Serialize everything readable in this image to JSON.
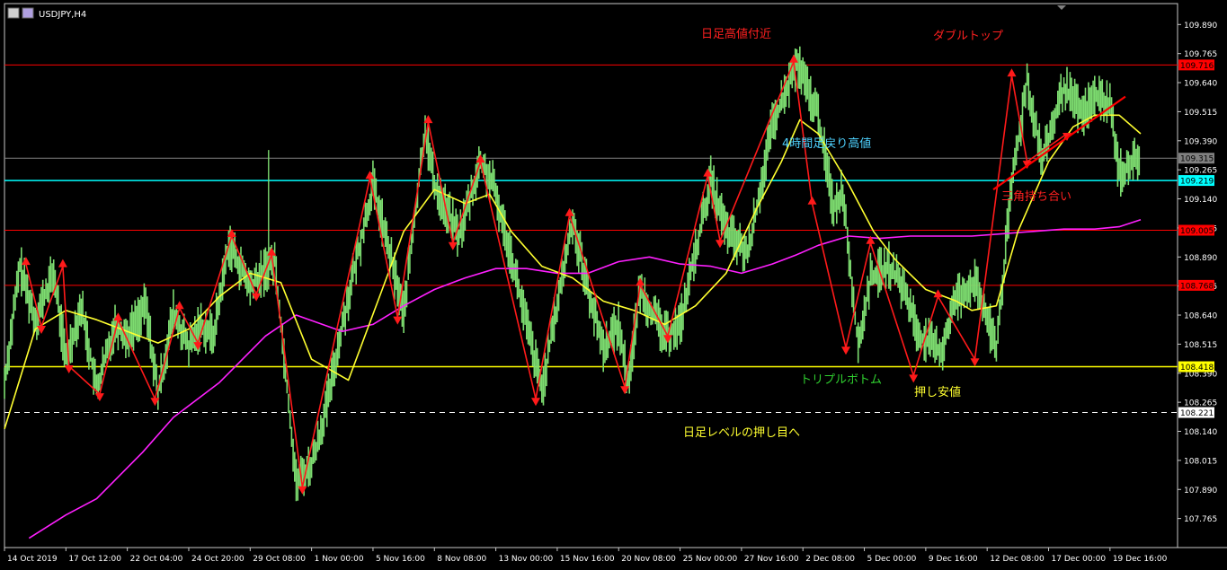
{
  "window": {
    "title": "USDJPY,H4"
  },
  "chart_data": {
    "type": "line",
    "symbol": "USDJPY,H4",
    "ylim": [
      107.64,
      109.98
    ],
    "y_ticks": [
      "109.890",
      "109.765",
      "109.640",
      "109.515",
      "109.390",
      "109.265",
      "109.140",
      "109.015",
      "108.890",
      "108.765",
      "108.640",
      "108.515",
      "108.390",
      "108.265",
      "108.140",
      "108.015",
      "107.890",
      "107.765"
    ],
    "x_labels": [
      "14 Oct 2019",
      "17 Oct 12:00",
      "22 Oct 04:00",
      "24 Oct 20:00",
      "29 Oct 08:00",
      "1 Nov 00:00",
      "5 Nov 16:00",
      "8 Nov 08:00",
      "13 Nov 00:00",
      "15 Nov 16:00",
      "20 Nov 08:00",
      "25 Nov 00:00",
      "27 Nov 16:00",
      "2 Dec 08:00",
      "5 Dec 00:00",
      "9 Dec 16:00",
      "12 Dec 08:00",
      "17 Dec 00:00",
      "19 Dec 16:00"
    ],
    "levels": [
      {
        "price": 109.716,
        "label": "109.716",
        "color": "#ff0000",
        "style": "solid"
      },
      {
        "price": 109.315,
        "label": "109.315",
        "color": "#808080",
        "style": "solid"
      },
      {
        "price": 109.219,
        "label": "109.219",
        "color": "#00ffff",
        "style": "solid"
      },
      {
        "price": 109.005,
        "label": "109.005",
        "color": "#ff0000",
        "style": "solid"
      },
      {
        "price": 108.768,
        "label": "108.768",
        "color": "#ff0000",
        "style": "solid"
      },
      {
        "price": 108.418,
        "label": "108.418",
        "color": "#ffff00",
        "style": "solid"
      },
      {
        "price": 108.221,
        "label": "108.221",
        "color": "#ffffff",
        "style": "dashed"
      }
    ],
    "price_path": [
      [
        0,
        108.35
      ],
      [
        0.5,
        108.85
      ],
      [
        1,
        108.62
      ],
      [
        1.6,
        108.82
      ],
      [
        2,
        108.45
      ],
      [
        2.5,
        108.68
      ],
      [
        3,
        108.32
      ],
      [
        3.6,
        108.6
      ],
      [
        4,
        108.55
      ],
      [
        4.6,
        108.68
      ],
      [
        5,
        108.3
      ],
      [
        5.5,
        108.65
      ],
      [
        6,
        108.5
      ],
      [
        6.4,
        108.6
      ],
      [
        6.8,
        108.55
      ],
      [
        7.3,
        108.95
      ],
      [
        8,
        108.76
      ],
      [
        8.8,
        108.88
      ],
      [
        9.3,
        108.2
      ],
      [
        9.5,
        107.92
      ],
      [
        10,
        108.0
      ],
      [
        10.5,
        108.25
      ],
      [
        11,
        108.6
      ],
      [
        12,
        109.2
      ],
      [
        13,
        108.65
      ],
      [
        13.7,
        109.45
      ],
      [
        14,
        109.2
      ],
      [
        14.8,
        108.98
      ],
      [
        15.5,
        109.3
      ],
      [
        15.9,
        109.2
      ],
      [
        16.5,
        108.9
      ],
      [
        17,
        108.6
      ],
      [
        17.5,
        108.32
      ],
      [
        18.5,
        109.05
      ],
      [
        19,
        108.75
      ],
      [
        19.5,
        108.5
      ],
      [
        20,
        108.6
      ],
      [
        20.3,
        108.35
      ],
      [
        20.7,
        108.75
      ],
      [
        21.5,
        108.55
      ],
      [
        22,
        108.6
      ],
      [
        23,
        109.22
      ],
      [
        23.5,
        109.0
      ],
      [
        24.2,
        108.9
      ],
      [
        25,
        109.45
      ],
      [
        25.8,
        109.72
      ],
      [
        26.5,
        109.5
      ],
      [
        27,
        109.1
      ],
      [
        27.3,
        109.18
      ],
      [
        27.8,
        108.5
      ],
      [
        28.2,
        108.8
      ],
      [
        28.8,
        108.85
      ],
      [
        29.3,
        108.75
      ],
      [
        29.8,
        108.55
      ],
      [
        30.5,
        108.48
      ],
      [
        31,
        108.72
      ],
      [
        31.6,
        108.78
      ],
      [
        32.3,
        108.5
      ],
      [
        32.8,
        109.2
      ],
      [
        33.3,
        109.65
      ],
      [
        33.8,
        109.3
      ],
      [
        34.5,
        109.62
      ],
      [
        35.1,
        109.5
      ],
      [
        35.5,
        109.58
      ],
      [
        36,
        109.55
      ],
      [
        36.3,
        109.25
      ],
      [
        37,
        109.32
      ]
    ],
    "ma_yellow": [
      [
        0,
        108.15
      ],
      [
        1,
        108.58
      ],
      [
        2,
        108.66
      ],
      [
        3,
        108.62
      ],
      [
        4,
        108.57
      ],
      [
        5,
        108.52
      ],
      [
        6,
        108.58
      ],
      [
        7,
        108.72
      ],
      [
        8,
        108.82
      ],
      [
        9,
        108.78
      ],
      [
        10,
        108.45
      ],
      [
        11.2,
        108.36
      ],
      [
        12.3,
        108.75
      ],
      [
        13,
        109.0
      ],
      [
        14,
        109.18
      ],
      [
        15,
        109.12
      ],
      [
        15.8,
        109.16
      ],
      [
        16.5,
        109.0
      ],
      [
        17.5,
        108.85
      ],
      [
        18.5,
        108.8
      ],
      [
        19.5,
        108.7
      ],
      [
        20.5,
        108.66
      ],
      [
        21.5,
        108.6
      ],
      [
        22.5,
        108.68
      ],
      [
        23.5,
        108.82
      ],
      [
        24.5,
        109.1
      ],
      [
        25.3,
        109.3
      ],
      [
        25.9,
        109.48
      ],
      [
        26.5,
        109.42
      ],
      [
        27.5,
        109.2
      ],
      [
        28.3,
        109.0
      ],
      [
        29,
        108.88
      ],
      [
        30,
        108.75
      ],
      [
        31,
        108.7
      ],
      [
        31.5,
        108.66
      ],
      [
        32.3,
        108.68
      ],
      [
        33,
        109.0
      ],
      [
        34,
        109.3
      ],
      [
        34.8,
        109.45
      ],
      [
        35.5,
        109.5
      ],
      [
        36.3,
        109.5
      ],
      [
        37,
        109.42
      ]
    ],
    "ma_magenta": [
      [
        0.8,
        107.68
      ],
      [
        2,
        107.78
      ],
      [
        3,
        107.85
      ],
      [
        4.5,
        108.05
      ],
      [
        5.5,
        108.2
      ],
      [
        7,
        108.35
      ],
      [
        8.5,
        108.55
      ],
      [
        9.5,
        108.64
      ],
      [
        11,
        108.57
      ],
      [
        12,
        108.6
      ],
      [
        13,
        108.68
      ],
      [
        14,
        108.75
      ],
      [
        15,
        108.8
      ],
      [
        16,
        108.84
      ],
      [
        17,
        108.84
      ],
      [
        18,
        108.82
      ],
      [
        19,
        108.82
      ],
      [
        20,
        108.87
      ],
      [
        21,
        108.89
      ],
      [
        22,
        108.86
      ],
      [
        23,
        108.85
      ],
      [
        24,
        108.82
      ],
      [
        25,
        108.86
      ],
      [
        25.8,
        108.9
      ],
      [
        26.5,
        108.94
      ],
      [
        27.5,
        108.98
      ],
      [
        28.5,
        108.97
      ],
      [
        29.5,
        108.98
      ],
      [
        30.5,
        108.98
      ],
      [
        31.5,
        108.98
      ],
      [
        32.5,
        108.99
      ],
      [
        33.5,
        109.0
      ],
      [
        34.5,
        109.01
      ],
      [
        35.5,
        109.01
      ],
      [
        36.3,
        109.02
      ],
      [
        37,
        109.05
      ]
    ],
    "red_arrows": [
      {
        "t": 0.7,
        "p": 108.86,
        "dir": "up"
      },
      {
        "t": 1.2,
        "p": 108.59,
        "dir": "down"
      },
      {
        "t": 1.9,
        "p": 108.85,
        "dir": "up"
      },
      {
        "t": 2.1,
        "p": 108.42,
        "dir": "down"
      },
      {
        "t": 3.1,
        "p": 108.3,
        "dir": "down"
      },
      {
        "t": 3.7,
        "p": 108.62,
        "dir": "up"
      },
      {
        "t": 4.9,
        "p": 108.28,
        "dir": "down"
      },
      {
        "t": 5.7,
        "p": 108.67,
        "dir": "up"
      },
      {
        "t": 6.3,
        "p": 108.52,
        "dir": "down"
      },
      {
        "t": 7.4,
        "p": 108.98,
        "dir": "up"
      },
      {
        "t": 8.2,
        "p": 108.73,
        "dir": "down"
      },
      {
        "t": 8.7,
        "p": 108.9,
        "dir": "up"
      },
      {
        "t": 9.7,
        "p": 107.9,
        "dir": "down"
      },
      {
        "t": 11.9,
        "p": 109.23,
        "dir": "up"
      },
      {
        "t": 12.8,
        "p": 108.63,
        "dir": "down"
      },
      {
        "t": 13.8,
        "p": 109.47,
        "dir": "up"
      },
      {
        "t": 14.6,
        "p": 108.95,
        "dir": "down"
      },
      {
        "t": 15.5,
        "p": 109.3,
        "dir": "up"
      },
      {
        "t": 17.3,
        "p": 108.28,
        "dir": "down"
      },
      {
        "t": 18.4,
        "p": 109.07,
        "dir": "up"
      },
      {
        "t": 20.2,
        "p": 108.33,
        "dir": "down"
      },
      {
        "t": 20.7,
        "p": 108.77,
        "dir": "up"
      },
      {
        "t": 21.6,
        "p": 108.55,
        "dir": "down"
      },
      {
        "t": 22.9,
        "p": 109.24,
        "dir": "up"
      },
      {
        "t": 23.3,
        "p": 108.96,
        "dir": "down"
      },
      {
        "t": 25.7,
        "p": 109.73,
        "dir": "up"
      },
      {
        "t": 26.3,
        "p": 109.12,
        "dir": "up"
      },
      {
        "t": 27.4,
        "p": 108.5,
        "dir": "down"
      },
      {
        "t": 28.2,
        "p": 108.95,
        "dir": "up"
      },
      {
        "t": 29.6,
        "p": 108.38,
        "dir": "down"
      },
      {
        "t": 30.4,
        "p": 108.72,
        "dir": "up"
      },
      {
        "t": 31.6,
        "p": 108.45,
        "dir": "down"
      },
      {
        "t": 32.8,
        "p": 109.67,
        "dir": "up"
      },
      {
        "t": 33.3,
        "p": 109.3,
        "dir": "down"
      },
      {
        "t": 34.6,
        "p": 109.42,
        "dir": "down"
      }
    ],
    "trendlines": [
      {
        "t1": 32.2,
        "p1": 109.18,
        "t2": 36.5,
        "p2": 109.58,
        "color": "#ff0000"
      }
    ],
    "annotations": {
      "daily_high": "日足高値付近",
      "double_top": "ダブルトップ",
      "h4_pullback_high": "4時間足戻り高値",
      "triangle": "三角持ち合い",
      "triple_bottom": "トリプルボトム",
      "push_low": "押し安値",
      "daily_pullback": "日足レベルの押し目へ"
    }
  }
}
